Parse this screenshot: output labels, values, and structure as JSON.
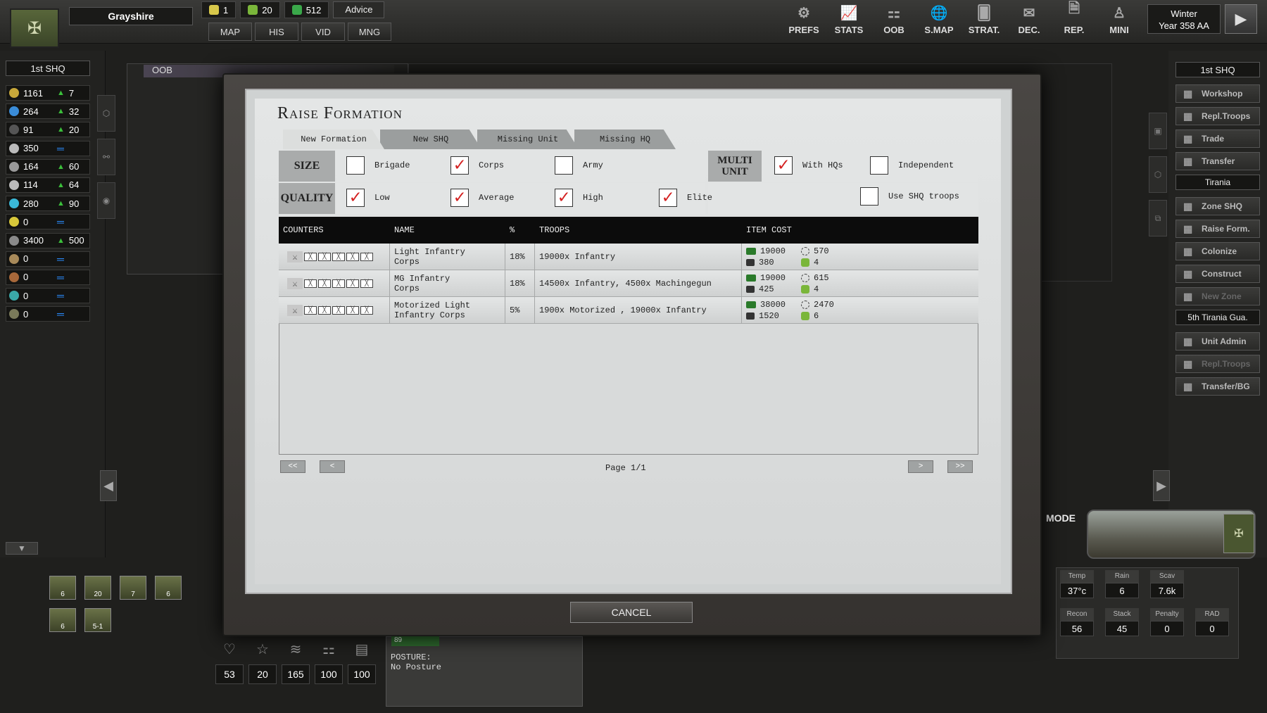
{
  "top": {
    "region": "Grayshire",
    "resources": [
      {
        "icon": "sun-icon",
        "value": "1",
        "color": "#d8c84a"
      },
      {
        "icon": "soldier-icon",
        "value": "20",
        "color": "#7ab63a"
      },
      {
        "icon": "money-icon",
        "value": "512",
        "color": "#3aa84a"
      }
    ],
    "advice": "Advice",
    "nav": [
      "MAP",
      "HIS",
      "VID",
      "MNG"
    ],
    "icons": [
      {
        "label": "PREFS",
        "icon": "gear-icon",
        "glyph": "⚙"
      },
      {
        "label": "STATS",
        "icon": "chart-icon",
        "glyph": "📈"
      },
      {
        "label": "OOB",
        "icon": "hierarchy-icon",
        "glyph": "⚏"
      },
      {
        "label": "S.MAP",
        "icon": "globe-icon",
        "glyph": "🌐"
      },
      {
        "label": "STRAT.",
        "icon": "cards-icon",
        "glyph": "🂠"
      },
      {
        "label": "DEC.",
        "icon": "mail-icon",
        "glyph": "✉"
      },
      {
        "label": "REP.",
        "icon": "report-icon",
        "glyph": "🗎"
      },
      {
        "label": "MINI",
        "icon": "person-icon",
        "glyph": "♙"
      }
    ],
    "season": "Winter",
    "year": "Year 358 AA"
  },
  "left": {
    "hq": "1st SHQ",
    "rows": [
      {
        "icon": "food-icon",
        "color": "#c8a83a",
        "value": "1161",
        "delta": "7",
        "type": "up"
      },
      {
        "icon": "water-icon",
        "color": "#3a8cd8",
        "value": "264",
        "delta": "32",
        "type": "up"
      },
      {
        "icon": "oil-icon",
        "color": "#555555",
        "value": "91",
        "delta": "20",
        "type": "up"
      },
      {
        "icon": "ammo-icon",
        "color": "#bbbbbb",
        "value": "350",
        "delta": "",
        "type": "eq"
      },
      {
        "icon": "metal-icon",
        "color": "#999999",
        "value": "164",
        "delta": "60",
        "type": "up"
      },
      {
        "icon": "parts-icon",
        "color": "#bbbbbb",
        "value": "114",
        "delta": "64",
        "type": "up"
      },
      {
        "icon": "energy-icon",
        "color": "#3ab8d8",
        "value": "280",
        "delta": "90",
        "type": "up"
      },
      {
        "icon": "radiation-icon",
        "color": "#d8c83a",
        "value": "0",
        "delta": "",
        "type": "eq"
      },
      {
        "icon": "manpower-icon",
        "color": "#8a8a8a",
        "value": "3400",
        "delta": "500",
        "type": "up"
      },
      {
        "icon": "helmet-icon",
        "color": "#a88a5a",
        "value": "0",
        "delta": "",
        "type": "eq"
      },
      {
        "icon": "rare-icon",
        "color": "#a8683a",
        "value": "0",
        "delta": "",
        "type": "eq"
      },
      {
        "icon": "chem-icon",
        "color": "#3aa8a8",
        "value": "0",
        "delta": "",
        "type": "eq"
      },
      {
        "icon": "building-icon",
        "color": "#7a7a5a",
        "value": "0",
        "delta": "",
        "type": "eq"
      }
    ]
  },
  "oob": {
    "title": "OOB"
  },
  "right": {
    "hq": "1st SHQ",
    "group1": [
      {
        "label": "Workshop",
        "icon": "workshop-icon",
        "enabled": true
      },
      {
        "label": "Repl.Troops",
        "icon": "troops-icon",
        "enabled": true
      },
      {
        "label": "Trade",
        "icon": "trade-icon",
        "enabled": true
      },
      {
        "label": "Transfer",
        "icon": "transfer-icon",
        "enabled": true
      }
    ],
    "zone": "Tirania",
    "group2": [
      {
        "label": "Zone SHQ",
        "icon": "zone-icon",
        "enabled": true
      },
      {
        "label": "Raise Form.",
        "icon": "raise-icon",
        "enabled": true
      },
      {
        "label": "Colonize",
        "icon": "colonize-icon",
        "enabled": true
      },
      {
        "label": "Construct",
        "icon": "construct-icon",
        "enabled": true
      },
      {
        "label": "New Zone",
        "icon": "newzone-icon",
        "enabled": false
      }
    ],
    "unit": "5th Tirania Gua.",
    "group3": [
      {
        "label": "Unit Admin",
        "icon": "admin-icon",
        "enabled": true
      },
      {
        "label": "Repl.Troops",
        "icon": "troops-icon",
        "enabled": false
      },
      {
        "label": "Transfer/BG",
        "icon": "transferbg-icon",
        "enabled": true
      }
    ]
  },
  "units": [
    "6",
    "20",
    "7",
    "6",
    "6",
    "5-1"
  ],
  "bottom": {
    "stats": [
      {
        "icon": "heart-icon",
        "glyph": "♡",
        "value": "53"
      },
      {
        "icon": "star-icon",
        "glyph": "☆",
        "value": "20"
      },
      {
        "icon": "wings-icon",
        "glyph": "≋",
        "value": "165"
      },
      {
        "icon": "hierarchy-icon",
        "glyph": "⚏",
        "value": "100"
      },
      {
        "icon": "barrel-icon",
        "glyph": "▤",
        "value": "100"
      }
    ],
    "bar": "89",
    "posture_label": "POSTURE:",
    "posture_value": "No Posture"
  },
  "mode": "MODE",
  "weather": [
    {
      "label": "Temp",
      "value": "37°c"
    },
    {
      "label": "Rain",
      "value": "6"
    },
    {
      "label": "Scav",
      "value": "7.6k"
    },
    {
      "label": "",
      "value": ""
    },
    {
      "label": "Recon",
      "value": "56"
    },
    {
      "label": "Stack",
      "value": "45"
    },
    {
      "label": "Penalty",
      "value": "0"
    },
    {
      "label": "RAD",
      "value": "0"
    }
  ],
  "dialog": {
    "title": "Raise Formation",
    "tabs": [
      "New Formation",
      "New SHQ",
      "Missing Unit",
      "Missing HQ"
    ],
    "size_label": "SIZE",
    "quality_label": "QUALITY",
    "multi_label": "MULTI UNIT",
    "size_opts": [
      {
        "label": "Brigade",
        "checked": false
      },
      {
        "label": "Corps",
        "checked": true
      },
      {
        "label": "Army",
        "checked": false
      }
    ],
    "quality_opts": [
      {
        "label": "Low",
        "checked": true
      },
      {
        "label": "Average",
        "checked": true
      },
      {
        "label": "High",
        "checked": true
      },
      {
        "label": "Elite",
        "checked": true
      }
    ],
    "multi_opts": [
      {
        "label": "With HQs",
        "checked": true
      },
      {
        "label": "Independent",
        "checked": false
      }
    ],
    "shq_opt": {
      "label": "Use SHQ troops",
      "checked": false
    },
    "columns": [
      "COUNTERS",
      "NAME",
      "%",
      "TROOPS",
      "ITEM COST"
    ],
    "rows": [
      {
        "name1": "Light Infantry",
        "name2": "Corps",
        "pct": "18%",
        "troops": "19000x Infantry",
        "c1": "19000",
        "c2": "570",
        "c3": "380",
        "c4": "4"
      },
      {
        "name1": "MG Infantry",
        "name2": "Corps",
        "pct": "18%",
        "troops": "14500x Infantry, 4500x Machingegun",
        "c1": "19000",
        "c2": "615",
        "c3": "425",
        "c4": "4"
      },
      {
        "name1": "Motorized Light",
        "name2": "Infantry Corps",
        "pct": "5%",
        "troops": "1900x Motorized , 19000x Infantry",
        "c1": "38000",
        "c2": "2470",
        "c3": "1520",
        "c4": "6"
      }
    ],
    "pager": {
      "first": "<<",
      "prev": "<",
      "page": "Page 1/1",
      "next": ">",
      "last": ">>"
    },
    "cancel": "CANCEL"
  }
}
